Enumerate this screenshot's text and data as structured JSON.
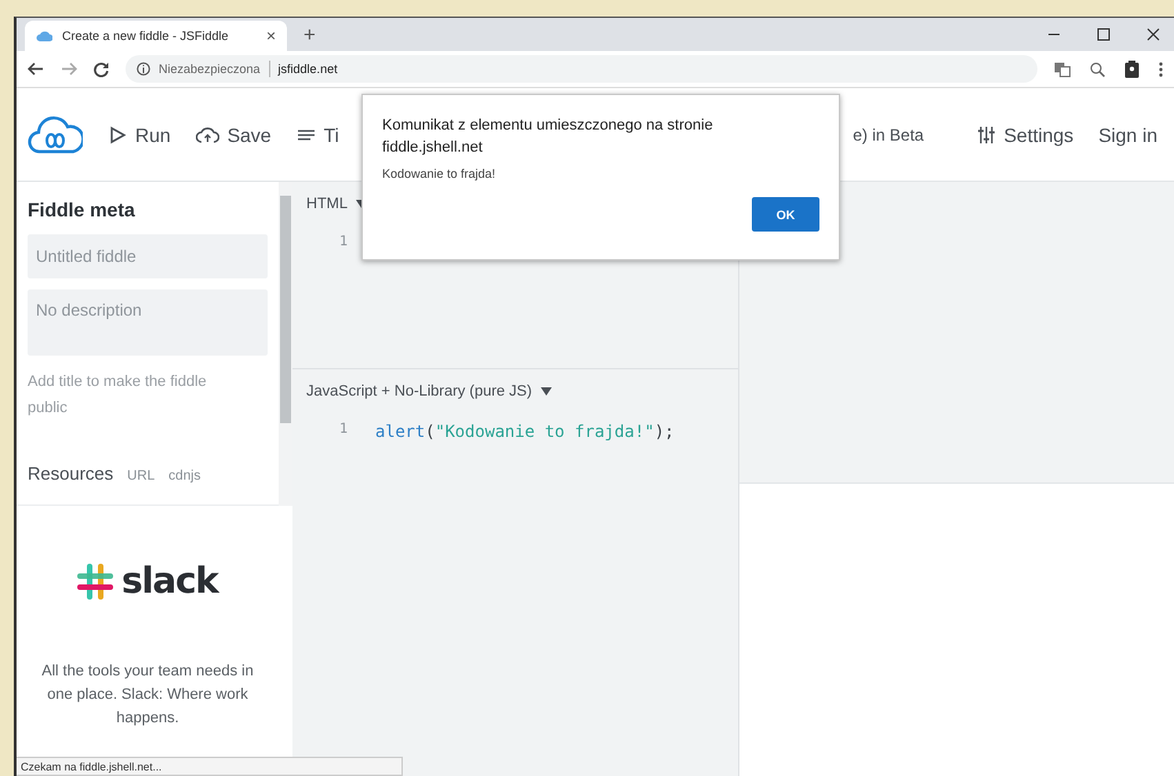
{
  "browser": {
    "tab_title": "Create a new fiddle - JSFiddle",
    "tab_close": "×",
    "new_tab": "+",
    "security_label": "Niezabezpieczona",
    "url": "jsfiddle.net",
    "status": "Czekam na fiddle.jshell.net..."
  },
  "header": {
    "actions": [
      {
        "kind": "play",
        "label": "Run"
      },
      {
        "kind": "upload",
        "label": "Save"
      },
      {
        "kind": "lines",
        "label": "Ti"
      }
    ],
    "beta_label": "e) in Beta",
    "settings": "Settings",
    "sign_in": "Sign in"
  },
  "sidebar": {
    "title": "Fiddle meta",
    "title_placeholder": "Untitled fiddle",
    "description_placeholder": "No description",
    "hint": "Add title to make the fiddle public",
    "resources_label": "Resources",
    "resource_tabs": [
      "URL",
      "cdnjs"
    ],
    "ad": {
      "brand": "slack",
      "text": "All the tools your team needs in one place. Slack: Where work happens."
    }
  },
  "panels": [
    {
      "label": "HTML",
      "lines": [
        {
          "number": "1"
        }
      ]
    },
    {
      "label": "JavaScript + No-Library (pure JS)",
      "lines": [
        {
          "number": "1",
          "tokens": [
            {
              "kind": "function",
              "text": "alert"
            },
            {
              "kind": "punct",
              "text": "("
            },
            {
              "kind": "string",
              "text": "\"Kodowanie to frajda!\""
            },
            {
              "kind": "punct",
              "text": ");"
            }
          ]
        }
      ]
    }
  ],
  "dialog": {
    "title": "Komunikat z elementu umieszczonego na stronie fiddle.jshell.net",
    "message": "Kodowanie to frajda!",
    "button": "OK"
  }
}
